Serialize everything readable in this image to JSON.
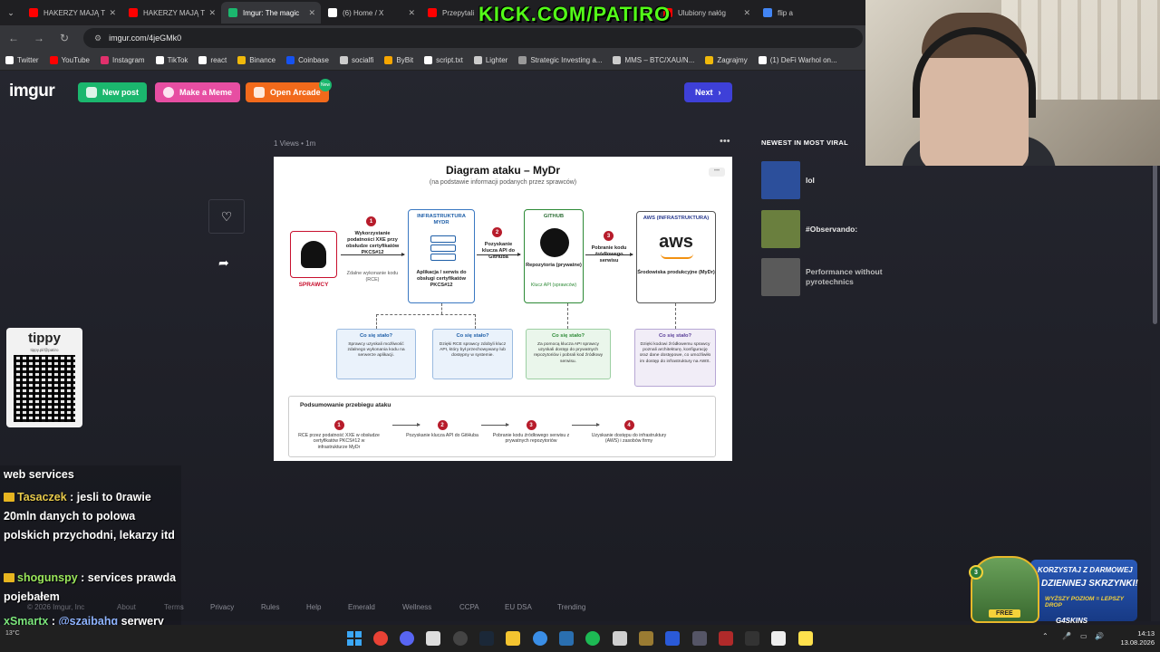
{
  "browser": {
    "tabs": [
      {
        "label": "HAKERZY MAJĄ T",
        "favicon_color": "#ff0000",
        "active": false
      },
      {
        "label": "HAKERZY MAJĄ T",
        "favicon_color": "#ff0000",
        "active": false
      },
      {
        "label": "Imgur: The magic",
        "favicon_color": "#1bb76e",
        "active": true
      },
      {
        "label": "(6) Home / X",
        "favicon_color": "#ffffff",
        "active": false
      },
      {
        "label": "Przepytali",
        "favicon_color": "#ff0000",
        "active": false
      },
      {
        "label": "SP",
        "favicon_color": "#888888",
        "active": false
      },
      {
        "label": "Ulubiony nałóg",
        "favicon_color": "#ff0000",
        "active": false
      },
      {
        "label": "flip a",
        "favicon_color": "#4285f4",
        "active": false
      }
    ],
    "url": "imgur.com/4jeGMk0",
    "bookmarks": [
      {
        "label": "Twitter",
        "color": "#ffffff"
      },
      {
        "label": "YouTube",
        "color": "#ff0000"
      },
      {
        "label": "Instagram",
        "color": "#e1306c"
      },
      {
        "label": "TikTok",
        "color": "#ffffff"
      },
      {
        "label": "react",
        "color": "#ffffff"
      },
      {
        "label": "Binance",
        "color": "#f0b90b"
      },
      {
        "label": "Coinbase",
        "color": "#1652f0"
      },
      {
        "label": "socialfi",
        "color": "#cccccc"
      },
      {
        "label": "ByBit",
        "color": "#f7a600"
      },
      {
        "label": "script.txt",
        "color": "#ffffff"
      },
      {
        "label": "Lighter",
        "color": "#cccccc"
      },
      {
        "label": "Strategic Investing a...",
        "color": "#999999"
      },
      {
        "label": "MMS – BTC/XAU/N...",
        "color": "#cccccc"
      },
      {
        "label": "Zagrajmy",
        "color": "#f0b90b"
      },
      {
        "label": "(1) DeFi Warhol on...",
        "color": "#ffffff"
      }
    ]
  },
  "overlay": {
    "kick_banner": "KICK.COM/PATIRO",
    "tippy_title": "tippy",
    "tippy_sub": "tippy.pl/@patiro",
    "chat": {
      "line0": "web services",
      "msg1_user": "Tasaczek",
      "msg1_text": ": jesli to 0rawie 20mln danych to polowa polskich przychodni, lekarzy itd",
      "msg2_user": "shogunspy",
      "msg2_text": ": services prawda pojebałem",
      "msg3_user": "xSmartx",
      "msg3_mention": "@szajbahq",
      "msg3_text": "serwery cłoudowe amazonu"
    },
    "promo": {
      "line1": "KORZYSTAJ Z DARMOWEJ",
      "line2": "DZIENNEJ SKRZYNKI!",
      "line3": "WYŻSZY POZIOM = LEPSZY DROP",
      "free": "FREE",
      "brand": "G4SKINS",
      "level": "3"
    }
  },
  "imgur": {
    "logo": "imgur",
    "new_post": "New post",
    "make_meme": "Make a Meme",
    "open_arcade": "Open Arcade",
    "arcade_badge": "New",
    "next": "Next",
    "views": "1 Views",
    "age": "1m",
    "newest_heading": "NEWEST IN MOST VIRAL",
    "viral": [
      {
        "label": "lol",
        "color": "#2c4f9b"
      },
      {
        "label": "#Observando:",
        "color": "#6a7f3e"
      },
      {
        "label": "Performance without pyrotechnics",
        "color": "#5a5a5a"
      }
    ],
    "footer": [
      "© 2026 Imgur, Inc",
      "About",
      "Terms",
      "Privacy",
      "Rules",
      "Help",
      "Emerald",
      "Wellness",
      "CCPA",
      "EU DSA",
      "Trending"
    ]
  },
  "diagram": {
    "title": "Diagram ataku – MyDr",
    "subtitle": "(na podstawie informacji podanych przez sprawców)",
    "attacker": "SPRAWCY",
    "step1_title": "Wykorzystanie podatności XXE przy obsłudze certyfikatów PKCS#12",
    "step1_sub": "Zdalne wykonanie kodu (RCE)",
    "infra_title": "INFRASTRUKTURA MYDR",
    "infra_body": "Aplikacja / serwis do obsługi certyfikatów PKCS#12",
    "step2_title": "Pozyskanie klucza API do GitHuba",
    "github_title": "GITHUB",
    "github_body": "Repozytoria (prywatne)",
    "github_key": "Klucz API (sprawców)",
    "step3_title": "Pobranie kodu źródłowego serwisu",
    "aws_title": "AWS (INFRASTRUKTURA)",
    "aws_logo": "aws",
    "aws_body": "Środowiska produkcyjne (MyDr)",
    "q": "Co się stało?",
    "box1": "Sprawcy uzyskali możliwość zdalnego wykonania kodu na serwerze aplikacji.",
    "box2": "Dzięki RCE sprawcy zdobyli klucz API, który był przechowywany lub dostępny w systemie.",
    "box3": "Za pomocą klucza API sprawcy uzyskali dostęp do prywatnych repozytoriów i pobrali kod źródłowy serwisu.",
    "box4": "Dzięki kodowi źródłowemu sprawcy poznali architekturę, konfigurację oraz dane dostępowe, co umożliwiło im dostęp do infrastruktury na AWS.",
    "summary_title": "Podsumowanie przebiegu ataku",
    "s1": "RCE przez podatność XXE w obsłudze certyfikatów PKCS#12 w infrastrukturze MyDr",
    "s2": "Pozyskanie klucza API do GitHuba",
    "s3": "Pobranie kodu źródłowego serwisu z prywatnych repozytoriów",
    "s4": "Uzyskanie dostępu do infrastruktury (AWS) i zasobów firmy"
  },
  "taskbar": {
    "time": "14:13",
    "date": "13.08.2026",
    "weather": "13°C"
  }
}
